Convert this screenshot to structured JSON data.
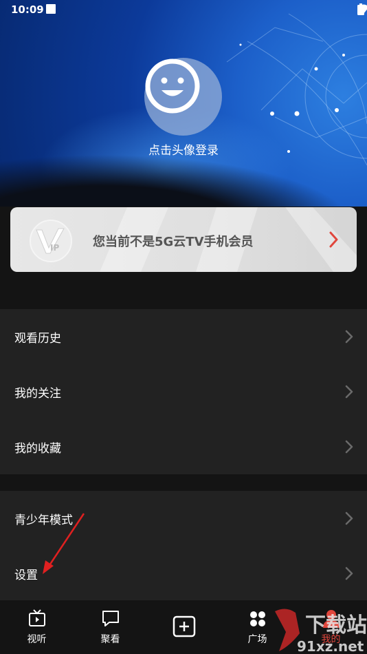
{
  "status_bar": {
    "time": "10:09"
  },
  "header": {
    "login_prompt": "点击头像登录"
  },
  "vip": {
    "badge_text": "V IP",
    "message": "您当前不是5G云TV手机会员"
  },
  "list_section_1": [
    {
      "label": "观看历史"
    },
    {
      "label": "我的关注"
    },
    {
      "label": "我的收藏"
    }
  ],
  "list_section_2": [
    {
      "label": "青少年模式"
    },
    {
      "label": "设置"
    }
  ],
  "bottom_nav": [
    {
      "label": "视听",
      "icon": "tv-icon"
    },
    {
      "label": "聚看",
      "icon": "chat-bubble-icon"
    },
    {
      "label": "",
      "icon": "add-square-icon"
    },
    {
      "label": "广场",
      "icon": "plaza-icon"
    },
    {
      "label": "我的",
      "icon": "profile-icon"
    }
  ],
  "watermark": {
    "text": "91xz.net",
    "logo_text": "下载站"
  },
  "colors": {
    "accent_red": "#e0463c",
    "list_bg": "#222222",
    "page_bg": "#141414"
  }
}
